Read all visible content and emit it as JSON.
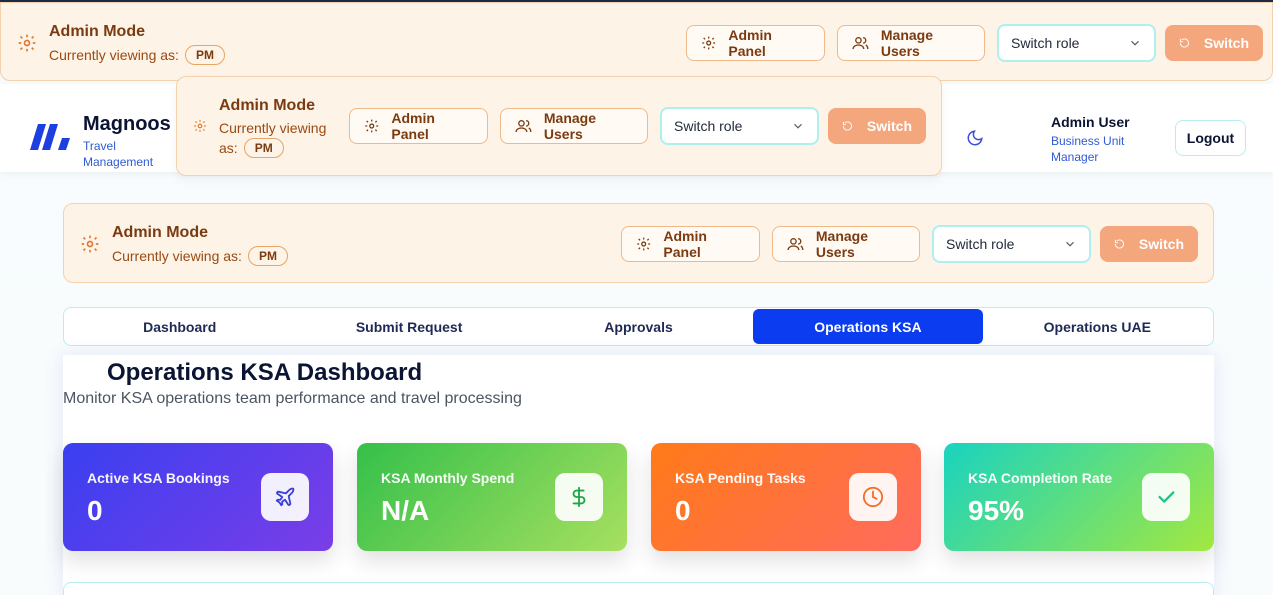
{
  "admin": {
    "title": "Admin Mode",
    "viewing_label": "Currently viewing as:",
    "viewing_label_wrapped_1": "Currently viewing",
    "viewing_label_wrapped_2": "as:",
    "role_badge": "PM",
    "admin_panel_label": "Admin Panel",
    "manage_users_label": "Manage Users",
    "switch_role_placeholder": "Switch role",
    "switch_label": "Switch"
  },
  "header": {
    "brand_name": "Magnoos",
    "brand_sub": "Travel Management",
    "user_name": "Admin User",
    "user_role": "Business Unit Manager",
    "logout_label": "Logout"
  },
  "tabs": [
    {
      "label": "Dashboard",
      "active": false
    },
    {
      "label": "Submit Request",
      "active": false
    },
    {
      "label": "Approvals",
      "active": false
    },
    {
      "label": "Operations KSA",
      "active": true
    },
    {
      "label": "Operations UAE",
      "active": false
    }
  ],
  "page": {
    "title": "Operations KSA Dashboard",
    "subtitle": "Monitor KSA operations team performance and travel processing"
  },
  "cards": [
    {
      "label": "Active KSA Bookings",
      "value": "0",
      "icon": "plane-icon",
      "icon_color": "#3b3fd8"
    },
    {
      "label": "KSA Monthly Spend",
      "value": "N/A",
      "icon": "dollar-icon",
      "icon_color": "#22a447"
    },
    {
      "label": "KSA Pending Tasks",
      "value": "0",
      "icon": "clock-icon",
      "icon_color": "#f0712a"
    },
    {
      "label": "KSA Completion Rate",
      "value": "95%",
      "icon": "check-icon",
      "icon_color": "#1ec28b"
    }
  ],
  "colors": {
    "accent": "#0b3cf0",
    "admin_bg": "#fdf3e7",
    "switch_bg": "#f4a67c"
  }
}
